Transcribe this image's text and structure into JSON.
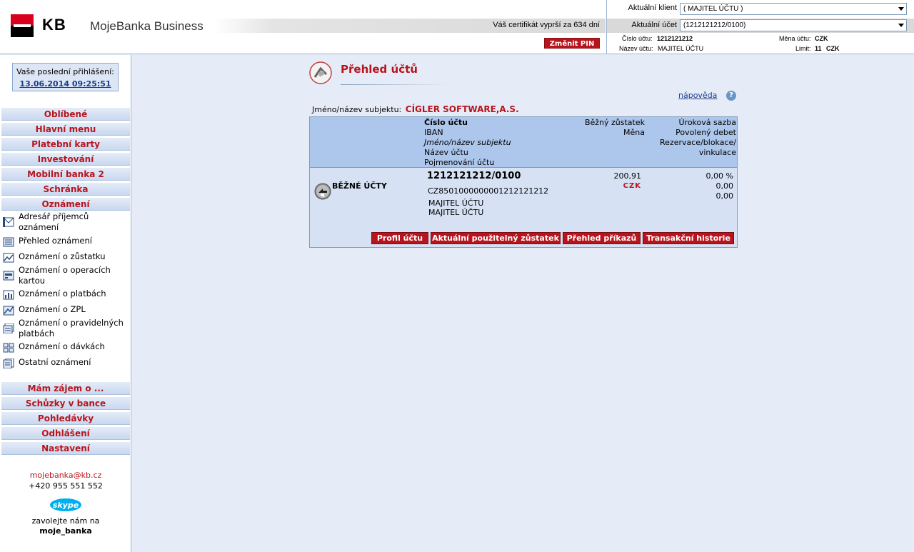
{
  "header": {
    "logo_text": "KB",
    "brand": "MojeBanka Business",
    "cert_text": "Váš certifikát vyprší za 634 dní",
    "change_pin": "Změnit PIN",
    "client_label": "Aktuální klient",
    "client_value": "( MAJITEL ÚČTU )",
    "account_label": "Aktuální účet",
    "account_value": "(1212121212/0100)",
    "acct_no_label": "Číslo účtu:",
    "acct_no_value": "1212121212",
    "acct_name_label": "Název účtu:",
    "acct_name_value": "MAJITEL ÚČTU",
    "currency_label": "Měna účtu:",
    "currency_value": "CZK",
    "limit_label": "Limit:",
    "limit_value": "11",
    "limit_currency": "CZK"
  },
  "sidebar": {
    "last_login_label": "Vaše poslední přihlášení:",
    "last_login_value": "13.06.2014 09:25:51",
    "menu_top": [
      "Oblíbené",
      "Hlavní menu",
      "Platební karty",
      "Investování",
      "Mobilní banka 2",
      "Schránka",
      "Oznámení"
    ],
    "sub_items": [
      {
        "label": "Adresář příjemců oznámení",
        "icon": "address-book-icon"
      },
      {
        "label": "Přehled oznámení",
        "icon": "list-icon"
      },
      {
        "label": "Oznámení o zůstatku",
        "icon": "chart-icon"
      },
      {
        "label": "Oznámení o operacích kartou",
        "icon": "card-icon"
      },
      {
        "label": "Oznámení o platbách",
        "icon": "bar-chart-icon"
      },
      {
        "label": "Oznámení o ZPL",
        "icon": "doc-chart-icon"
      },
      {
        "label": "Oznámení o pravidelných platbách",
        "icon": "docs-icon"
      },
      {
        "label": "Oznámení o dávkách",
        "icon": "batch-icon"
      },
      {
        "label": "Ostatní oznámení",
        "icon": "doc-icon"
      }
    ],
    "menu_bottom": [
      "Mám zájem o ...",
      "Schůzky v bance",
      "Pohledávky",
      "Odhlášení",
      "Nastavení"
    ],
    "email": "mojebanka@kb.cz",
    "phone": "+420 955 551 552",
    "skype_logo": "skype",
    "skype_call": "zavolejte nám na",
    "skype_user": "moje_banka"
  },
  "main": {
    "title": "Přehled účtů",
    "help": "nápověda",
    "subject_label": "Jméno/název subjektu:",
    "subject_name": "CÍGLER SOFTWARE,A.S.",
    "headers": {
      "col1": [
        "Číslo účtu",
        "IBAN",
        "Jméno/název subjektu",
        "Název účtu",
        "Pojmenování účtu"
      ],
      "balance": "Běžný zůstatek",
      "currency": "Měna",
      "rate": "Úroková sazba",
      "overdraft": "Povolený debet",
      "reserve1": "Rezervace/blokace/",
      "reserve2": "vinkulace"
    },
    "row": {
      "type": "BĚŽNÉ ÚČTY",
      "number": "1212121212/0100",
      "iban": "CZ8501000000001212121212",
      "owner1": "MAJITEL ÚČTU",
      "owner2": "MAJITEL ÚČTU",
      "balance": "200,91",
      "currency": "CZK",
      "rate": "0,00 %",
      "overdraft": "0,00",
      "reserve": "0,00"
    },
    "buttons": [
      "Profil účtu",
      "Aktuální použitelný zůstatek",
      "Přehled příkazů",
      "Transakční historie"
    ]
  }
}
